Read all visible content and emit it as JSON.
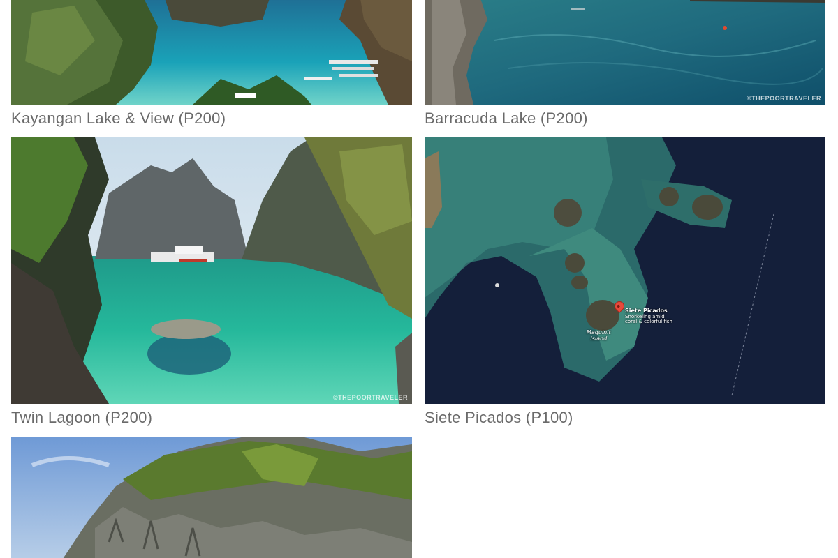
{
  "gallery": {
    "items": [
      {
        "caption": "Kayangan Lake & View (P200)",
        "watermark": ""
      },
      {
        "caption": "Barracuda Lake (P200)",
        "watermark": "©THEPOORTRAVELER"
      },
      {
        "caption": "Twin Lagoon (P200)",
        "watermark": "©THEPOORTRAVELER"
      },
      {
        "caption": "Siete Picados (P100)",
        "watermark": ""
      },
      {
        "caption": "",
        "watermark": ""
      }
    ],
    "map": {
      "pin_title": "Siete Picados",
      "pin_desc_line1": "Snorkeling amid",
      "pin_desc_line2": "coral & colorful fish",
      "island_line1": "Maquinit",
      "island_line2": "Island"
    }
  },
  "icons": {
    "map_pin": "map-pin-icon"
  }
}
